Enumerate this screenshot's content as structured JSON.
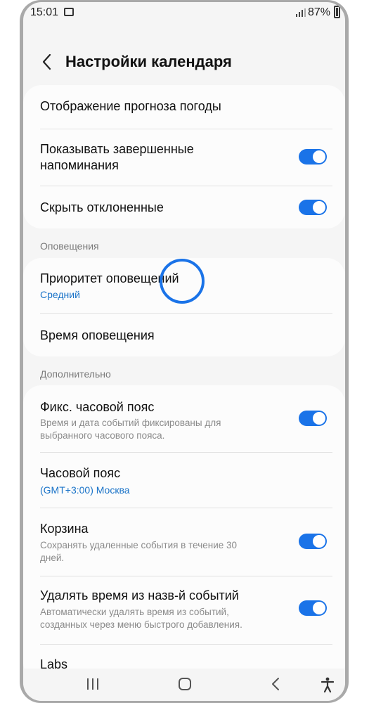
{
  "status": {
    "time": "15:01",
    "battery": "87%"
  },
  "header": {
    "title": "Настройки календаря"
  },
  "card1": {
    "weather": "Отображение прогноза погоды",
    "completed_reminders": "Показывать завершенные напоминания",
    "completed_reminders_on": true,
    "hide_declined": "Скрыть отклоненные",
    "hide_declined_on": true
  },
  "notifications": {
    "section": "Оповещения",
    "priority_label": "Приоритет оповещений",
    "priority_value": "Средний",
    "time_label": "Время оповещения"
  },
  "advanced": {
    "section": "Дополнительно",
    "fixed_tz_label": "Фикс. часовой пояс",
    "fixed_tz_desc": "Время и дата событий фиксированы для выбранного часового пояса.",
    "fixed_tz_on": true,
    "timezone_label": "Часовой пояс",
    "timezone_value": "(GMT+3:00) Москва",
    "trash_label": "Корзина",
    "trash_desc": "Сохранять удаленные события в течение 30 дней.",
    "trash_on": true,
    "remove_time_label": "Удалять время из назв-й событий",
    "remove_time_desc": "Автоматически удалять время из событий, созданных через меню быстрого добавления.",
    "remove_time_on": true,
    "labs_label": "Labs"
  },
  "icons": {
    "back": "chevron-left-icon",
    "recent": "recent-apps-icon",
    "home": "home-icon",
    "nav_back": "back-icon",
    "accessibility": "accessibility-icon"
  }
}
